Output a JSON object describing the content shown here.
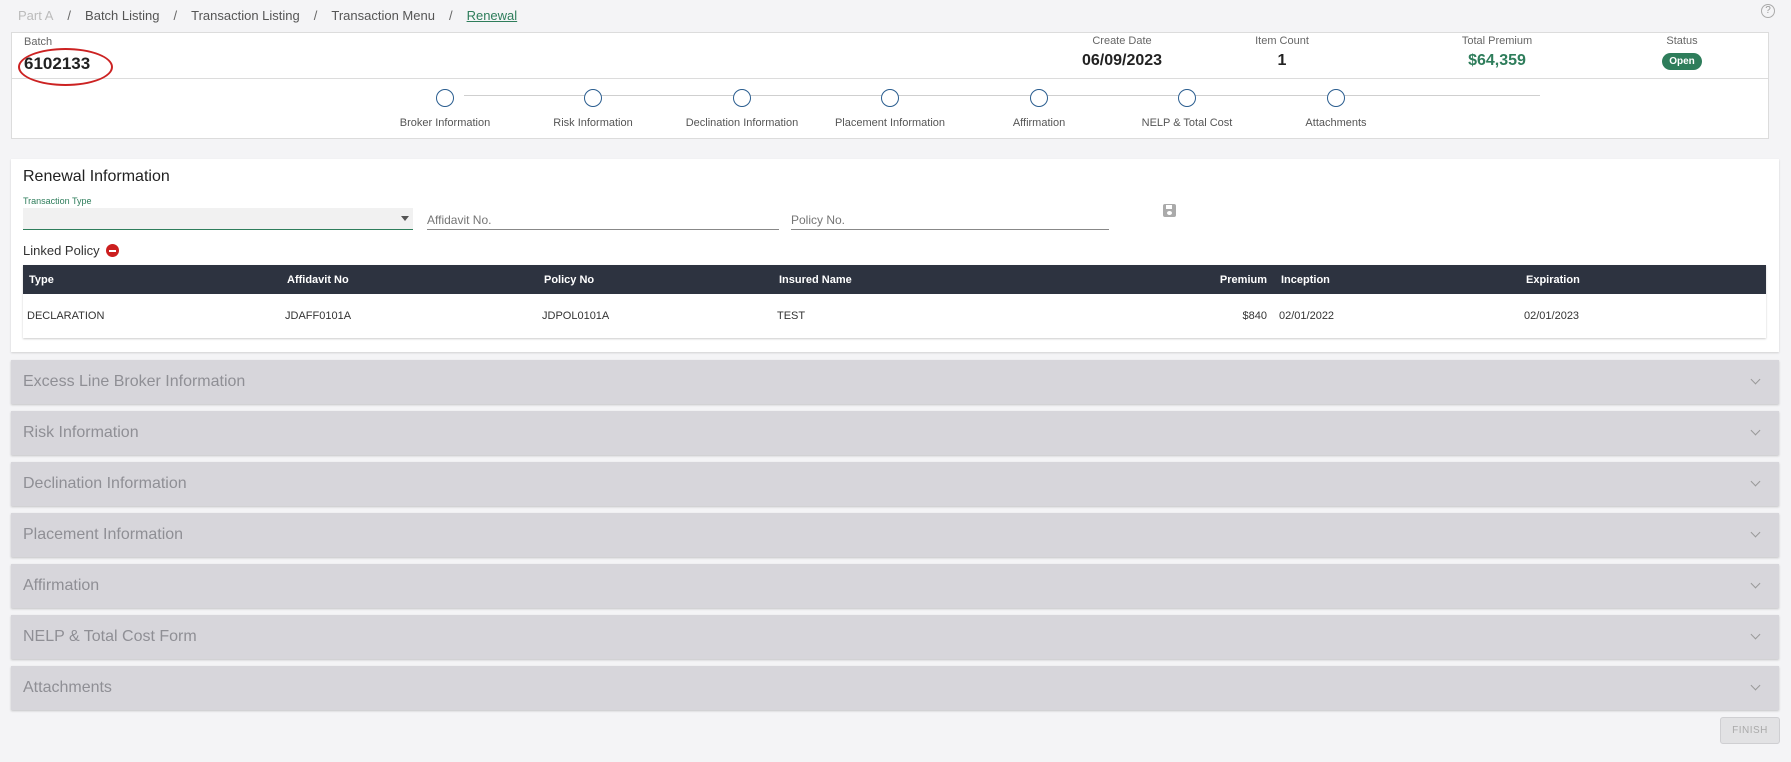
{
  "breadcrumb": {
    "items": [
      "Part A",
      "Batch Listing",
      "Transaction Listing",
      "Transaction Menu",
      "Renewal"
    ],
    "separator": "/"
  },
  "help": {
    "icon": "help-circle-icon",
    "glyph": "?"
  },
  "header": {
    "batch_label": "Batch",
    "batch_number": "6102133",
    "create_date_label": "Create Date",
    "create_date": "06/09/2023",
    "item_count_label": "Item Count",
    "item_count": "1",
    "total_premium_label": "Total Premium",
    "total_premium": "$64,359",
    "status_label": "Status",
    "status": "Open",
    "accent_color": "#2e7d5b",
    "highlight_color": "#cc2222"
  },
  "stepper": {
    "steps": [
      {
        "label": "Broker Information"
      },
      {
        "label": "Risk Information"
      },
      {
        "label": "Declination Information"
      },
      {
        "label": "Placement Information"
      },
      {
        "label": "Affirmation"
      },
      {
        "label": "NELP & Total Cost"
      },
      {
        "label": "Attachments"
      }
    ]
  },
  "renewal": {
    "title": "Renewal Information",
    "transaction_type_label": "Transaction Type",
    "transaction_type_value": "",
    "affidavit_placeholder": "Affidavit No.",
    "policy_placeholder": "Policy No.",
    "save_icon": "save-icon",
    "linked_policy_label": "Linked Policy",
    "table": {
      "headers": [
        "Type",
        "Affidavit No",
        "Policy No",
        "Insured Name",
        "Premium",
        "Inception",
        "Expiration"
      ],
      "rows": [
        [
          "DECLARATION",
          "JDAFF0101A",
          "JDPOL0101A",
          "TEST",
          "$840",
          "02/01/2022",
          "02/01/2023"
        ]
      ]
    }
  },
  "accordions": [
    {
      "title": "Excess Line Broker Information"
    },
    {
      "title": "Risk Information"
    },
    {
      "title": "Declination Information"
    },
    {
      "title": "Placement Information"
    },
    {
      "title": "Affirmation"
    },
    {
      "title": "NELP & Total Cost Form"
    },
    {
      "title": "Attachments"
    }
  ],
  "finish_label": "FINISH"
}
